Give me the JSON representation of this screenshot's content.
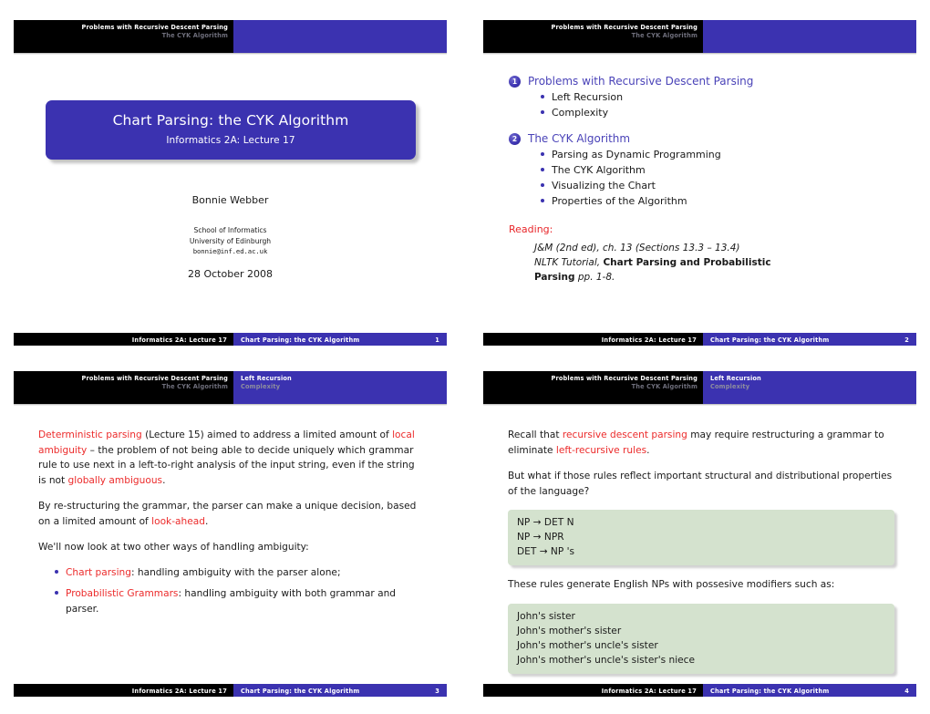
{
  "deck": {
    "course_footer": "Informatics 2A: Lecture 17",
    "title_footer": "Chart Parsing: the CYK Algorithm",
    "colors": {
      "blue": "#3b32b0",
      "black": "#000000",
      "red": "#ec2b2b",
      "link_blue": "#4a43b8",
      "green_box": "#d4e2ce"
    }
  },
  "slide1": {
    "header": {
      "left_line1": "Problems with Recursive Descent Parsing",
      "left_line2": "The CYK Algorithm",
      "right_line1": "",
      "right_line2": ""
    },
    "title": "Chart Parsing: the CYK Algorithm",
    "subtitle": "Informatics 2A: Lecture 17",
    "author": "Bonnie Webber",
    "affiliation_line1": "School of Informatics",
    "affiliation_line2": "University of Edinburgh",
    "email": "bonnie@inf.ed.ac.uk",
    "date": "28 October 2008",
    "page_number": "1"
  },
  "slide2": {
    "header": {
      "left_line1": "Problems with Recursive Descent Parsing",
      "left_line2": "The CYK Algorithm",
      "right_line1": "",
      "right_line2": ""
    },
    "sections": [
      {
        "number": "1",
        "title": "Problems with Recursive Descent Parsing",
        "items": [
          "Left Recursion",
          "Complexity"
        ]
      },
      {
        "number": "2",
        "title": "The CYK Algorithm",
        "items": [
          "Parsing as Dynamic Programming",
          "The CYK Algorithm",
          "Visualizing the Chart",
          "Properties of the Algorithm"
        ]
      }
    ],
    "reading_label": "Reading:",
    "reading_line1": "J&M (2nd ed), ch. 13 (Sections 13.3 – 13.4)",
    "reading_line2_pre": "NLTK Tutorial, ",
    "reading_line2_bold": "Chart Parsing and Probabilistic",
    "reading_line3_bold": "Parsing",
    "reading_line3_post": " pp. 1-8.",
    "page_number": "2"
  },
  "slide3": {
    "header": {
      "left_line1": "Problems with Recursive Descent Parsing",
      "left_line2": "The CYK Algorithm",
      "right_line1": "Left Recursion",
      "right_line2": "Complexity"
    },
    "para1": {
      "p1": "Deterministic parsing",
      "p2": " (Lecture 15) aimed to address a limited amount of ",
      "p3": "local ambiguity",
      "p4": " – the problem of not being able to decide uniquely which grammar rule to use next in a left-to-right analysis of the input string, even if the string is not ",
      "p5": "globally ambiguous",
      "p6": "."
    },
    "para2": {
      "p1": "By re-structuring the grammar, the parser can make a unique decision, based on a limited amount of ",
      "p2": "look-ahead",
      "p3": "."
    },
    "para3": "We'll now look at two other ways of handling ambiguity:",
    "bullets": [
      {
        "red": "Chart parsing",
        "rest": ": handling ambiguity with the parser alone;"
      },
      {
        "red": "Probabilistic Grammars",
        "rest": ": handling ambiguity with both grammar and parser."
      }
    ],
    "page_number": "3"
  },
  "slide4": {
    "header": {
      "left_line1": "Problems with Recursive Descent Parsing",
      "left_line2": "The CYK Algorithm",
      "right_line1": "Left Recursion",
      "right_line2": "Complexity"
    },
    "para1": {
      "p1": "Recall that ",
      "p2": "recursive descent parsing",
      "p3": " may require restructuring a grammar to eliminate ",
      "p4": "left-recursive rules",
      "p5": "."
    },
    "para2": "But what if those rules reflect important structural and distributional properties of the language?",
    "grammar_box": [
      "NP → DET N",
      "NP → NPR",
      "DET → NP 's"
    ],
    "para3": "These rules generate English NPs with possesive modifiers such as:",
    "examples_box": [
      "John's sister",
      "John's mother's sister",
      "John's mother's uncle's sister",
      "John's mother's uncle's sister's niece"
    ],
    "page_number": "4"
  }
}
